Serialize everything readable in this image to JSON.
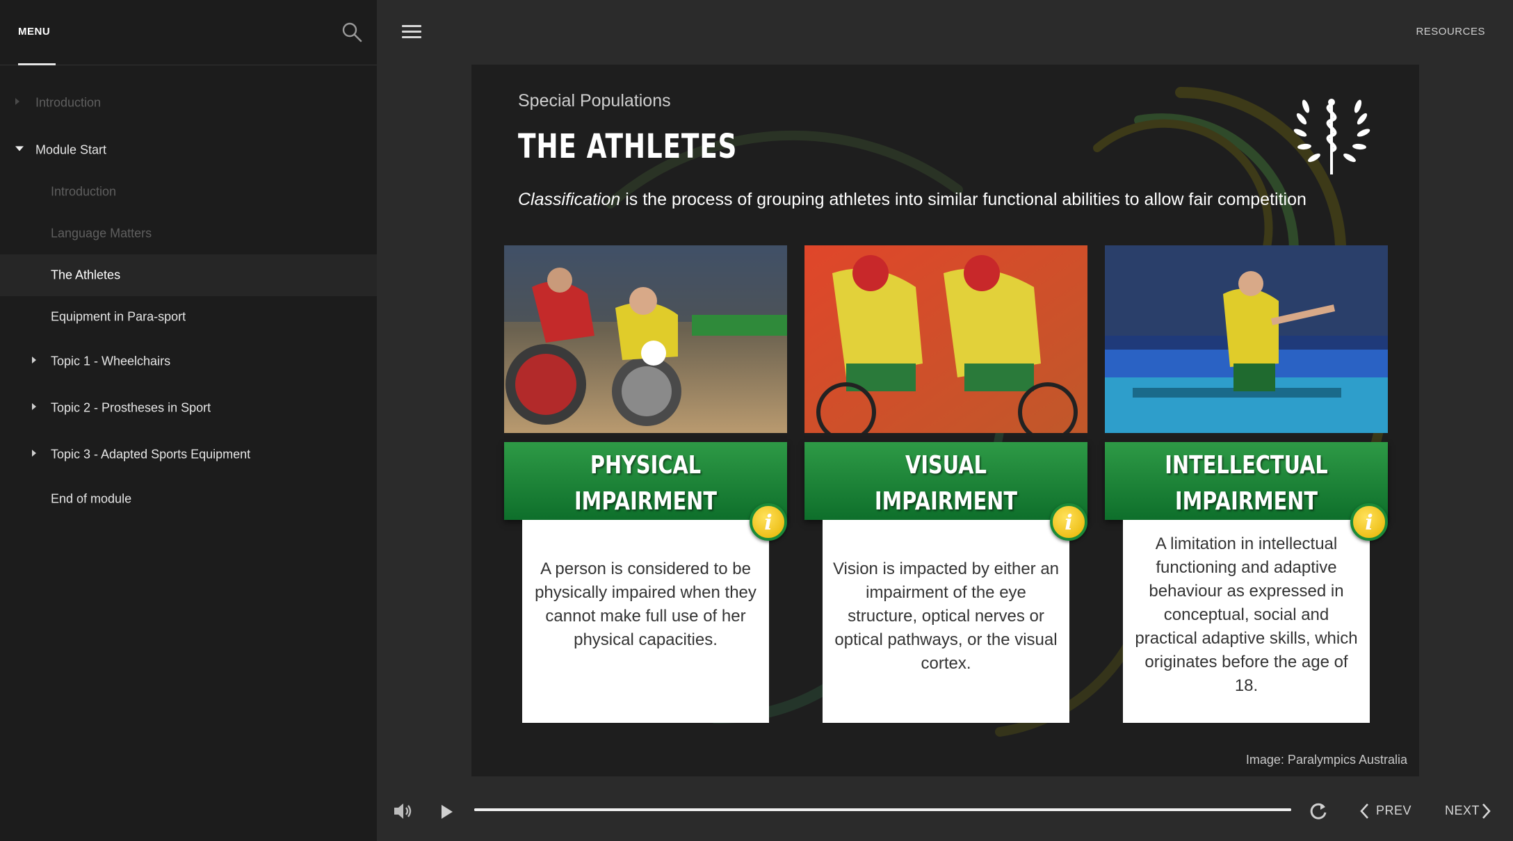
{
  "sidebar": {
    "tab_label": "MENU",
    "search_icon": "search-icon",
    "items": [
      {
        "label": "Introduction",
        "level": 0,
        "caret": "right",
        "state": "dim"
      },
      {
        "label": "Module Start",
        "level": 0,
        "caret": "down",
        "state": "normal"
      },
      {
        "label": "Introduction",
        "level": 1,
        "caret": "none",
        "state": "dim"
      },
      {
        "label": "Language Matters",
        "level": 1,
        "caret": "none",
        "state": "dim"
      },
      {
        "label": "The Athletes",
        "level": 1,
        "caret": "none",
        "state": "active"
      },
      {
        "label": "Equipment in Para-sport",
        "level": 1,
        "caret": "none",
        "state": "normal"
      },
      {
        "label": "Topic 1 - Wheelchairs",
        "level": 1,
        "caret": "right",
        "state": "normal"
      },
      {
        "label": "Topic 2 - Prostheses in Sport",
        "level": 1,
        "caret": "right",
        "state": "normal"
      },
      {
        "label": "Topic 3 - Adapted Sports Equipment",
        "level": 1,
        "caret": "right",
        "state": "normal"
      },
      {
        "label": "End of module",
        "level": 1,
        "caret": "none",
        "state": "normal"
      }
    ]
  },
  "header": {
    "resources_label": "RESOURCES"
  },
  "slide": {
    "subtitle": "Special Populations",
    "title": "THE ATHLETES",
    "intro_em": "Classification",
    "intro_rest": " is the process of grouping athletes into similar functional abilities to allow fair competition",
    "cards": [
      {
        "line1": "PHYSICAL",
        "line2": "IMPAIRMENT",
        "text": "A person is considered to be physically impaired when they cannot make full use of her physical capacities.",
        "photo": "wheelchair-rugby-photo"
      },
      {
        "line1": "VISUAL",
        "line2": "IMPAIRMENT",
        "text": "Vision is impacted by either an impairment of the eye structure, optical nerves or optical pathways, or the visual cortex.",
        "photo": "tandem-cycling-photo"
      },
      {
        "line1": "INTELLECTUAL",
        "line2": "IMPAIRMENT",
        "text": "A limitation in intellectual functioning and adaptive behaviour as expressed in conceptual, social and practical adaptive skills, which originates before the age of 18.",
        "photo": "table-tennis-photo"
      }
    ],
    "info_glyph": "i",
    "credit": "Image: Paralympics Australia"
  },
  "player": {
    "progress": 1.0,
    "prev_label": "PREV",
    "next_label": "NEXT"
  },
  "colors": {
    "banner_green": "#1a8a38",
    "info_yellow": "#f2c200",
    "sidebar_bg": "#1c1c1c",
    "main_bg": "#2b2b2b"
  }
}
